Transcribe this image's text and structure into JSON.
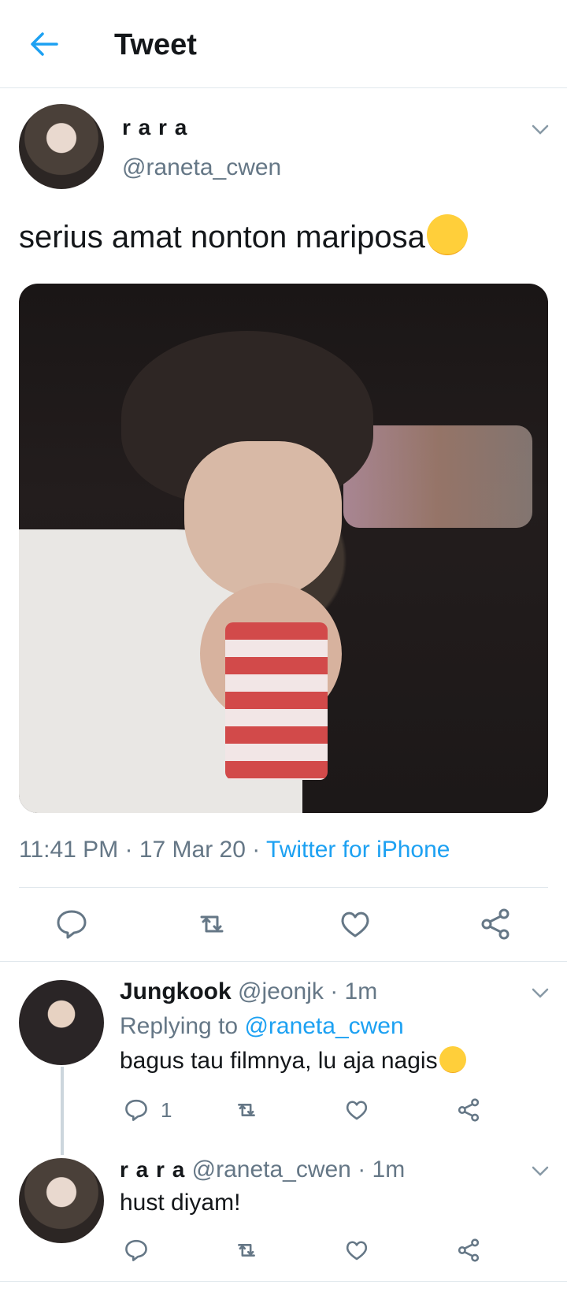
{
  "header": {
    "title": "Tweet"
  },
  "tweet": {
    "display_name": "r a r a",
    "handle": "@raneta_cwen",
    "text": "serius amat nonton mariposa",
    "emoji": "loudly-crying-face",
    "time": "11:41 PM · 17 Mar 20 · ",
    "source": "Twitter for iPhone"
  },
  "replies": [
    {
      "display_name": "Jungkook",
      "handle": "@jeonjk · 1m",
      "replying_label": "Replying to ",
      "replying_handle": "@raneta_cwen",
      "text": "bagus tau filmnya, lu aja nagis",
      "emoji": "frowning-face",
      "reply_count": "1"
    },
    {
      "display_name": "r a r a",
      "handle": "@raneta_cwen · 1m",
      "text": "hust diyam!"
    }
  ],
  "colors": {
    "accent": "#1da1f2",
    "muted": "#657786",
    "divider": "#e1e8ed",
    "text": "#14171a"
  }
}
